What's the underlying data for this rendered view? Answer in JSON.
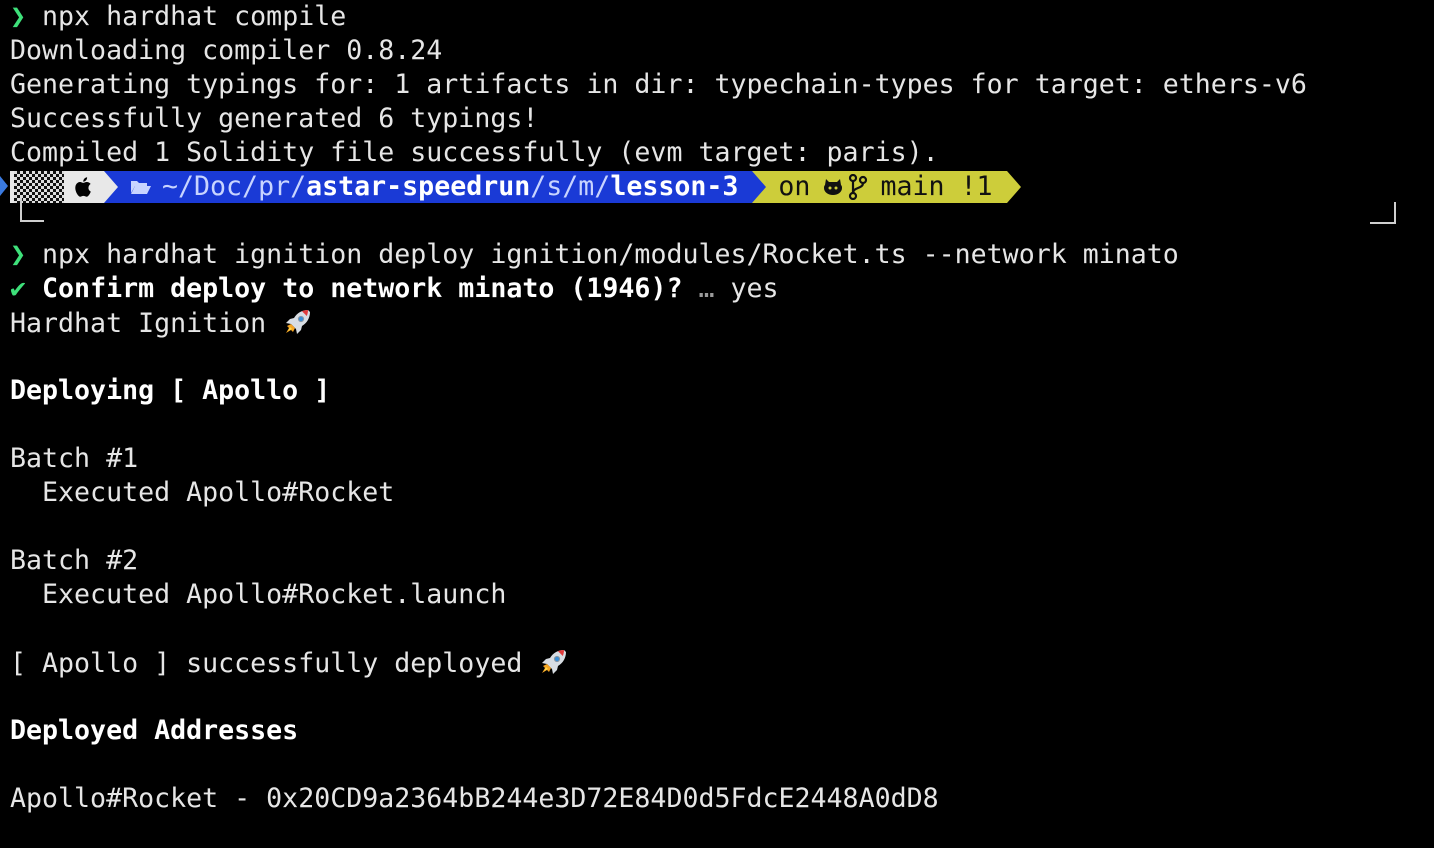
{
  "terminal": {
    "prompt_symbol": "❯",
    "cmd1": "npx hardhat compile",
    "out1": "Downloading compiler 0.8.24",
    "out2": "Generating typings for: 1 artifacts in dir: typechain-types for target: ethers-v6",
    "out3": "Successfully generated 6 typings!",
    "out4": "Compiled 1 Solidity file successfully (evm target: paris).",
    "prompt": {
      "dir_prefix": "~/Doc/pr/",
      "dir_bold": "astar-speedrun",
      "dir_mid": "/s/m/",
      "dir_last": "lesson-3",
      "git_on": "on",
      "git_branch": "main",
      "git_status": "!1"
    },
    "cmd2": "npx hardhat ignition deploy ignition/modules/Rocket.ts --network minato",
    "check_symbol": "✔",
    "confirm_text": "Confirm deploy to network minato (1946)?",
    "confirm_ellipsis": "…",
    "confirm_answer": "yes",
    "ignition_title": "Hardhat Ignition",
    "deploying": "Deploying [ Apollo ]",
    "batch1": "Batch #1",
    "batch1_exec": "  Executed Apollo#Rocket",
    "batch2": "Batch #2",
    "batch2_exec": "  Executed Apollo#Rocket.launch",
    "success": "[ Apollo ] successfully deployed",
    "deployed_addresses": "Deployed Addresses",
    "address_line": "Apollo#Rocket - 0x20CD9a2364bB244e3D72E84D0d5FdcE2448A0dD8"
  },
  "colors": {
    "background": "#000000",
    "prompt_green": "#3ee07a",
    "dir_blue": "#1a3ad6",
    "git_yellow": "#cdcd3a",
    "os_gray": "#e8e8e8"
  },
  "icons": [
    "apple-icon",
    "folder-open-icon",
    "github-icon",
    "git-branch-icon",
    "rocket-icon"
  ]
}
